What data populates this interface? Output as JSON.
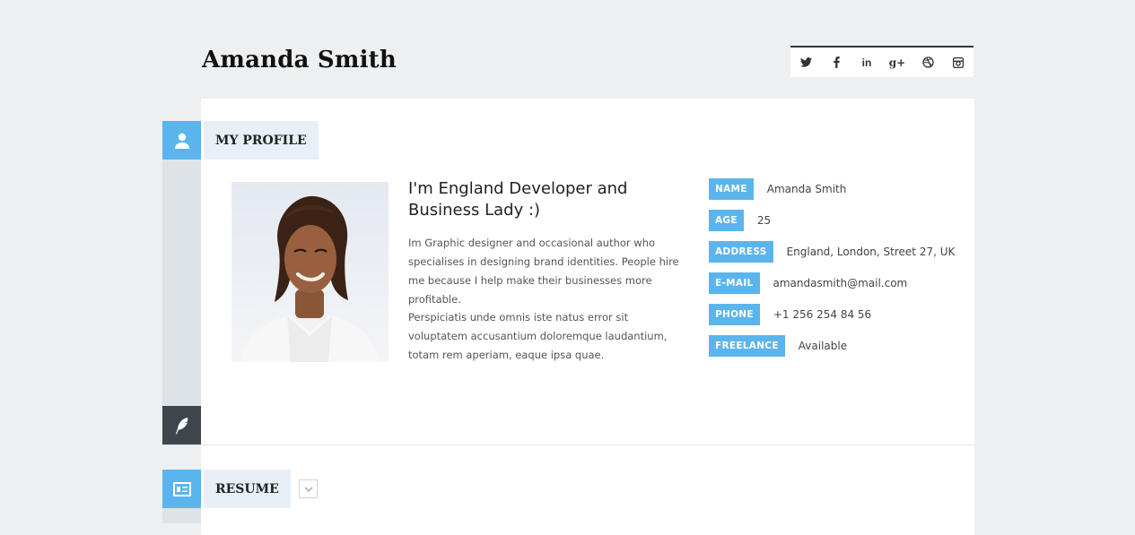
{
  "header": {
    "name": "Amanda Smith"
  },
  "social": [
    {
      "icon": "twitter-icon",
      "glyph": "t"
    },
    {
      "icon": "facebook-icon",
      "glyph": "f"
    },
    {
      "icon": "linkedin-icon",
      "glyph": "in"
    },
    {
      "icon": "google-plus-icon",
      "glyph": "g+"
    },
    {
      "icon": "dribbble-icon",
      "glyph": "◍"
    },
    {
      "icon": "instagram-icon",
      "glyph": "◘"
    }
  ],
  "profile": {
    "section_title": "MY PROFILE",
    "headline": "I'm England Developer and Business Lady :)",
    "paragraph1": "Im Graphic designer and occasional author who specialises in designing brand identities. People hire me because I help make their businesses more profitable.",
    "paragraph2": "Perspiciatis unde omnis iste natus error sit voluptatem accusantium doloremque laudantium, totam rem aperiam, eaque ipsa quae.",
    "info": [
      {
        "key": "NAME",
        "value": "Amanda Smith"
      },
      {
        "key": "AGE",
        "value": "25"
      },
      {
        "key": "ADDRESS",
        "value": "England, London, Street 27, UK"
      },
      {
        "key": "E-MAIL",
        "value": "amandasmith@mail.com"
      },
      {
        "key": "PHONE",
        "value": "+1 256 254 84 56"
      },
      {
        "key": "FREELANCE",
        "value": "Available"
      }
    ]
  },
  "resume": {
    "section_title": "RESUME"
  },
  "colors": {
    "accent": "#5bb5ec",
    "rail": "#dde3e7",
    "dark": "#3d454d",
    "background": "#eeeff0"
  }
}
